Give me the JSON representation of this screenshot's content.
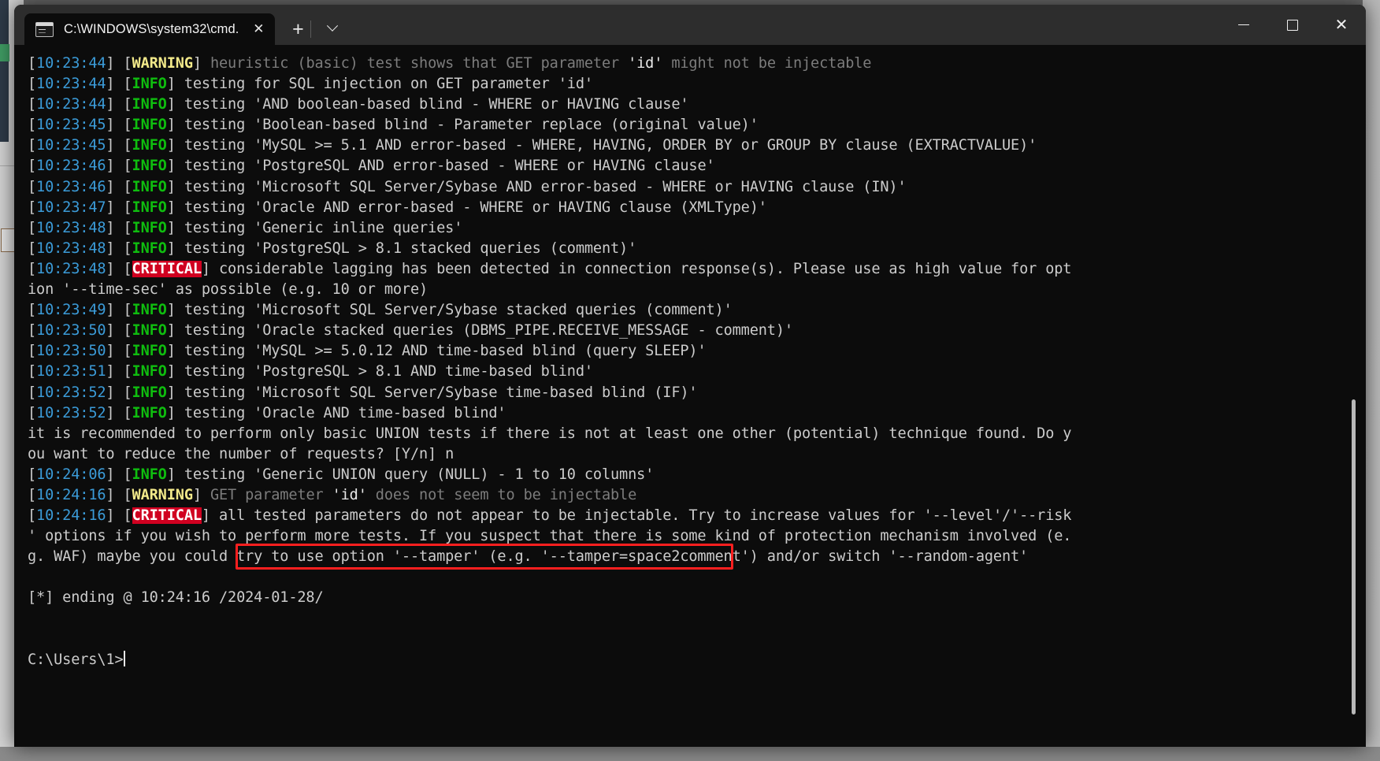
{
  "window": {
    "tab_title": "C:\\WINDOWS\\system32\\cmd.",
    "tab_close_label": "✕",
    "new_tab_label": "+",
    "dropdown_label": "",
    "minimize_label": "",
    "maximize_label": "",
    "close_label": "✕",
    "accent_red": "#ff1f1f",
    "critical_bg": "#d00020",
    "info_green": "#0fbd0f",
    "warning_yellow": "#f2e98a",
    "timestamp_blue": "#3b9bd8",
    "background": "#0c0c0c"
  },
  "terminal": {
    "prompt": "C:\\Users\\1>",
    "lines": [
      {
        "id": "l1",
        "parts": [
          {
            "cls": "brk",
            "text": "["
          },
          {
            "cls": "ts",
            "text": "10:23:44"
          },
          {
            "cls": "brk",
            "text": "] ["
          },
          {
            "cls": "warn",
            "text": "WARNING"
          },
          {
            "cls": "brk",
            "text": "] "
          },
          {
            "cls": "dim",
            "text": "heuristic (basic) test shows that GET parameter "
          },
          {
            "cls": "bright",
            "text": "'id'"
          },
          {
            "cls": "dim",
            "text": " might not be injectable"
          }
        ]
      },
      {
        "id": "l2",
        "parts": [
          {
            "cls": "brk",
            "text": "["
          },
          {
            "cls": "ts",
            "text": "10:23:44"
          },
          {
            "cls": "brk",
            "text": "] ["
          },
          {
            "cls": "info",
            "text": "INFO"
          },
          {
            "cls": "brk",
            "text": "] "
          },
          {
            "cls": "txt",
            "text": "testing for SQL injection on GET parameter 'id'"
          }
        ]
      },
      {
        "id": "l3",
        "parts": [
          {
            "cls": "brk",
            "text": "["
          },
          {
            "cls": "ts",
            "text": "10:23:44"
          },
          {
            "cls": "brk",
            "text": "] ["
          },
          {
            "cls": "info",
            "text": "INFO"
          },
          {
            "cls": "brk",
            "text": "] "
          },
          {
            "cls": "txt",
            "text": "testing 'AND boolean-based blind - WHERE or HAVING clause'"
          }
        ]
      },
      {
        "id": "l4",
        "parts": [
          {
            "cls": "brk",
            "text": "["
          },
          {
            "cls": "ts",
            "text": "10:23:45"
          },
          {
            "cls": "brk",
            "text": "] ["
          },
          {
            "cls": "info",
            "text": "INFO"
          },
          {
            "cls": "brk",
            "text": "] "
          },
          {
            "cls": "txt",
            "text": "testing 'Boolean-based blind - Parameter replace (original value)'"
          }
        ]
      },
      {
        "id": "l5",
        "parts": [
          {
            "cls": "brk",
            "text": "["
          },
          {
            "cls": "ts",
            "text": "10:23:45"
          },
          {
            "cls": "brk",
            "text": "] ["
          },
          {
            "cls": "info",
            "text": "INFO"
          },
          {
            "cls": "brk",
            "text": "] "
          },
          {
            "cls": "txt",
            "text": "testing 'MySQL >= 5.1 AND error-based - WHERE, HAVING, ORDER BY or GROUP BY clause (EXTRACTVALUE)'"
          }
        ]
      },
      {
        "id": "l6",
        "parts": [
          {
            "cls": "brk",
            "text": "["
          },
          {
            "cls": "ts",
            "text": "10:23:46"
          },
          {
            "cls": "brk",
            "text": "] ["
          },
          {
            "cls": "info",
            "text": "INFO"
          },
          {
            "cls": "brk",
            "text": "] "
          },
          {
            "cls": "txt",
            "text": "testing 'PostgreSQL AND error-based - WHERE or HAVING clause'"
          }
        ]
      },
      {
        "id": "l7",
        "parts": [
          {
            "cls": "brk",
            "text": "["
          },
          {
            "cls": "ts",
            "text": "10:23:46"
          },
          {
            "cls": "brk",
            "text": "] ["
          },
          {
            "cls": "info",
            "text": "INFO"
          },
          {
            "cls": "brk",
            "text": "] "
          },
          {
            "cls": "txt",
            "text": "testing 'Microsoft SQL Server/Sybase AND error-based - WHERE or HAVING clause (IN)'"
          }
        ]
      },
      {
        "id": "l8",
        "parts": [
          {
            "cls": "brk",
            "text": "["
          },
          {
            "cls": "ts",
            "text": "10:23:47"
          },
          {
            "cls": "brk",
            "text": "] ["
          },
          {
            "cls": "info",
            "text": "INFO"
          },
          {
            "cls": "brk",
            "text": "] "
          },
          {
            "cls": "txt",
            "text": "testing 'Oracle AND error-based - WHERE or HAVING clause (XMLType)'"
          }
        ]
      },
      {
        "id": "l9",
        "parts": [
          {
            "cls": "brk",
            "text": "["
          },
          {
            "cls": "ts",
            "text": "10:23:48"
          },
          {
            "cls": "brk",
            "text": "] ["
          },
          {
            "cls": "info",
            "text": "INFO"
          },
          {
            "cls": "brk",
            "text": "] "
          },
          {
            "cls": "txt",
            "text": "testing 'Generic inline queries'"
          }
        ]
      },
      {
        "id": "l10",
        "parts": [
          {
            "cls": "brk",
            "text": "["
          },
          {
            "cls": "ts",
            "text": "10:23:48"
          },
          {
            "cls": "brk",
            "text": "] ["
          },
          {
            "cls": "info",
            "text": "INFO"
          },
          {
            "cls": "brk",
            "text": "] "
          },
          {
            "cls": "txt",
            "text": "testing 'PostgreSQL > 8.1 stacked queries (comment)'"
          }
        ]
      },
      {
        "id": "l11",
        "parts": [
          {
            "cls": "brk",
            "text": "["
          },
          {
            "cls": "ts",
            "text": "10:23:48"
          },
          {
            "cls": "brk",
            "text": "] ["
          },
          {
            "cls": "crit",
            "text": "CRITICAL"
          },
          {
            "cls": "brk",
            "text": "] "
          },
          {
            "cls": "txt",
            "text": "considerable lagging has been detected in connection response(s). Please use as high value for opt"
          }
        ]
      },
      {
        "id": "l12",
        "parts": [
          {
            "cls": "txt",
            "text": "ion '--time-sec' as possible (e.g. 10 or more)"
          }
        ]
      },
      {
        "id": "l13",
        "parts": [
          {
            "cls": "brk",
            "text": "["
          },
          {
            "cls": "ts",
            "text": "10:23:49"
          },
          {
            "cls": "brk",
            "text": "] ["
          },
          {
            "cls": "info",
            "text": "INFO"
          },
          {
            "cls": "brk",
            "text": "] "
          },
          {
            "cls": "txt",
            "text": "testing 'Microsoft SQL Server/Sybase stacked queries (comment)'"
          }
        ]
      },
      {
        "id": "l14",
        "parts": [
          {
            "cls": "brk",
            "text": "["
          },
          {
            "cls": "ts",
            "text": "10:23:50"
          },
          {
            "cls": "brk",
            "text": "] ["
          },
          {
            "cls": "info",
            "text": "INFO"
          },
          {
            "cls": "brk",
            "text": "] "
          },
          {
            "cls": "txt",
            "text": "testing 'Oracle stacked queries (DBMS_PIPE.RECEIVE_MESSAGE - comment)'"
          }
        ]
      },
      {
        "id": "l15",
        "parts": [
          {
            "cls": "brk",
            "text": "["
          },
          {
            "cls": "ts",
            "text": "10:23:50"
          },
          {
            "cls": "brk",
            "text": "] ["
          },
          {
            "cls": "info",
            "text": "INFO"
          },
          {
            "cls": "brk",
            "text": "] "
          },
          {
            "cls": "txt",
            "text": "testing 'MySQL >= 5.0.12 AND time-based blind (query SLEEP)'"
          }
        ]
      },
      {
        "id": "l16",
        "parts": [
          {
            "cls": "brk",
            "text": "["
          },
          {
            "cls": "ts",
            "text": "10:23:51"
          },
          {
            "cls": "brk",
            "text": "] ["
          },
          {
            "cls": "info",
            "text": "INFO"
          },
          {
            "cls": "brk",
            "text": "] "
          },
          {
            "cls": "txt",
            "text": "testing 'PostgreSQL > 8.1 AND time-based blind'"
          }
        ]
      },
      {
        "id": "l17",
        "parts": [
          {
            "cls": "brk",
            "text": "["
          },
          {
            "cls": "ts",
            "text": "10:23:52"
          },
          {
            "cls": "brk",
            "text": "] ["
          },
          {
            "cls": "info",
            "text": "INFO"
          },
          {
            "cls": "brk",
            "text": "] "
          },
          {
            "cls": "txt",
            "text": "testing 'Microsoft SQL Server/Sybase time-based blind (IF)'"
          }
        ]
      },
      {
        "id": "l18",
        "parts": [
          {
            "cls": "brk",
            "text": "["
          },
          {
            "cls": "ts",
            "text": "10:23:52"
          },
          {
            "cls": "brk",
            "text": "] ["
          },
          {
            "cls": "info",
            "text": "INFO"
          },
          {
            "cls": "brk",
            "text": "] "
          },
          {
            "cls": "txt",
            "text": "testing 'Oracle AND time-based blind'"
          }
        ]
      },
      {
        "id": "l19",
        "parts": [
          {
            "cls": "txt",
            "text": "it is recommended to perform only basic UNION tests if there is not at least one other (potential) technique found. Do y"
          }
        ]
      },
      {
        "id": "l20",
        "parts": [
          {
            "cls": "txt",
            "text": "ou want to reduce the number of requests? [Y/n] n"
          }
        ]
      },
      {
        "id": "l21",
        "parts": [
          {
            "cls": "brk",
            "text": "["
          },
          {
            "cls": "ts",
            "text": "10:24:06"
          },
          {
            "cls": "brk",
            "text": "] ["
          },
          {
            "cls": "info",
            "text": "INFO"
          },
          {
            "cls": "brk",
            "text": "] "
          },
          {
            "cls": "txt",
            "text": "testing 'Generic UNION query (NULL) - 1 to 10 columns'"
          }
        ]
      },
      {
        "id": "l22",
        "parts": [
          {
            "cls": "brk",
            "text": "["
          },
          {
            "cls": "ts",
            "text": "10:24:16"
          },
          {
            "cls": "brk",
            "text": "] ["
          },
          {
            "cls": "warn",
            "text": "WARNING"
          },
          {
            "cls": "brk",
            "text": "] "
          },
          {
            "cls": "dim",
            "text": "GET parameter "
          },
          {
            "cls": "bright",
            "text": "'id'"
          },
          {
            "cls": "dim",
            "text": " does not seem to be injectable"
          }
        ]
      },
      {
        "id": "l23",
        "parts": [
          {
            "cls": "brk",
            "text": "["
          },
          {
            "cls": "ts",
            "text": "10:24:16"
          },
          {
            "cls": "brk",
            "text": "] ["
          },
          {
            "cls": "crit",
            "text": "CRITICAL"
          },
          {
            "cls": "brk",
            "text": "] "
          },
          {
            "cls": "txt",
            "text": "all tested parameters do not appear to be injectable. Try to increase values for '--level'/'--risk"
          }
        ]
      },
      {
        "id": "l24",
        "parts": [
          {
            "cls": "txt",
            "text": "' options if you wish to perform more tests. If you suspect that there is some kind of protection mechanism involved (e."
          }
        ]
      },
      {
        "id": "l25",
        "parts": [
          {
            "cls": "txt",
            "text": "g. WAF) maybe you could try to use option '--tamper' (e.g. '--tamper=space2comment') and/or switch '--random-agent'"
          }
        ]
      },
      {
        "id": "l26",
        "parts": [
          {
            "cls": "txt",
            "text": " "
          }
        ]
      },
      {
        "id": "l27",
        "parts": [
          {
            "cls": "txt",
            "text": "[*] ending @ 10:24:16 /2024-01-28/"
          }
        ]
      },
      {
        "id": "l28",
        "parts": [
          {
            "cls": "txt",
            "text": " "
          }
        ]
      },
      {
        "id": "l29",
        "parts": [
          {
            "cls": "txt",
            "text": " "
          }
        ]
      }
    ],
    "annotation": {
      "label": "highlight-box",
      "highlighted_text": "all tested parameters do not appear to be injectable.",
      "color": "#ff1f1f"
    }
  },
  "desktop": {
    "left_tab_label": ""
  }
}
